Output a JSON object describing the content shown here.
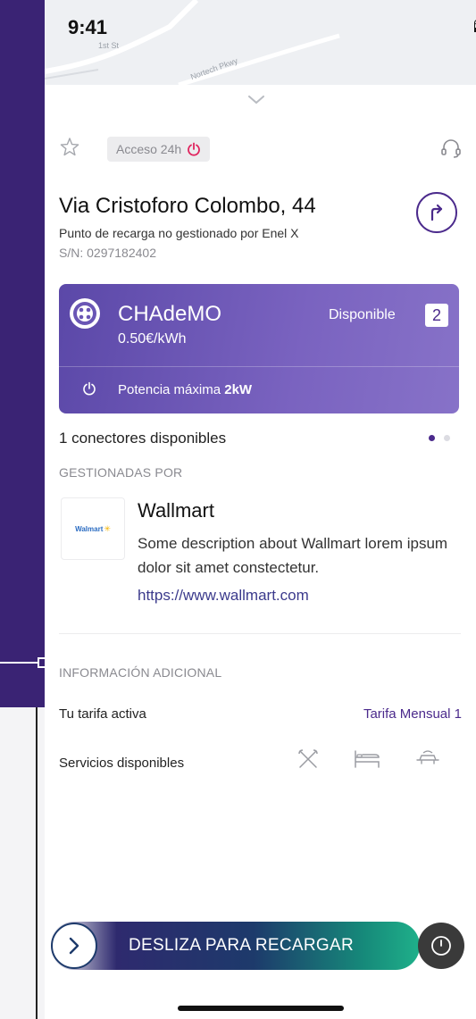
{
  "status_bar": {
    "time": "9:41"
  },
  "map": {
    "street_1": "1st St",
    "street_2": "Nortech Pkwy"
  },
  "header": {
    "access_badge": "Acceso 24h"
  },
  "location": {
    "title": "Via Cristoforo Colombo, 44",
    "subtitle": "Punto de recarga no gestionado por Enel X",
    "serial": "S/N: 0297182402"
  },
  "connector_card": {
    "name": "CHAdeMO",
    "price": "0.50€/kWh",
    "status": "Disponible",
    "count": "2",
    "power_label": "Potencia máxima",
    "power_value": "2kW",
    "color_start": "#5b48a8",
    "color_end": "#8772c8"
  },
  "availability": {
    "text": "1 conectores disponibles",
    "pages": 2,
    "active_page": 1
  },
  "managed_by": {
    "section_title": "GESTIONADAS POR",
    "logo_text": "Walmart",
    "company": "Wallmart",
    "description": "Some description about Wallmart lorem ipsum dolor sit amet constectetur.",
    "url": "https://www.wallmart.com"
  },
  "additional_info": {
    "section_title": "INFORMACIÓN ADICIONAL",
    "tariff_label": "Tu tarifa activa",
    "tariff_value": "Tarifa Mensual 1",
    "services_label": "Servicios disponibles",
    "services": [
      "restaurant-icon",
      "hotel-bed-icon",
      "car-wash-icon"
    ]
  },
  "slide_action": {
    "label": "DESLIZA PARA RECARGAR"
  },
  "colors": {
    "brand_purple": "#4b2a8c",
    "accent_green": "#1fb08a",
    "background_purple": "#3a2374"
  }
}
